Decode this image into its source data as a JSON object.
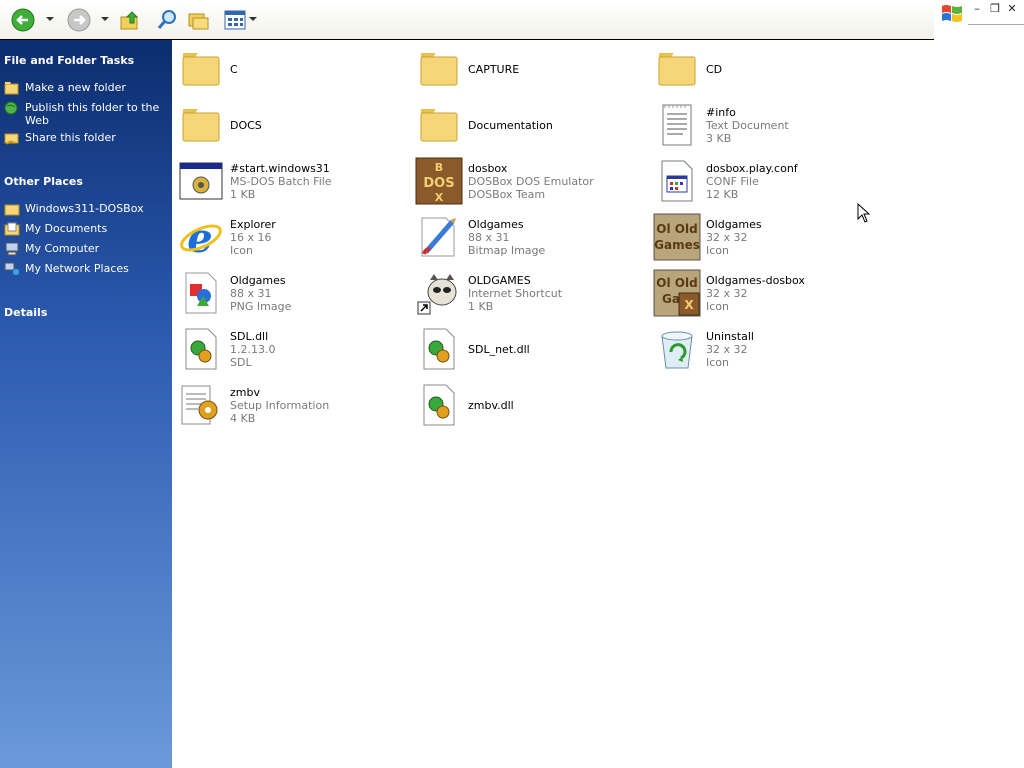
{
  "colors": {
    "pane_dark": "#0c2d6e",
    "pane_light": "#6b99da",
    "folder": "#f5d77a",
    "meta_gray": "#7a7a7a"
  },
  "toolbar": {
    "buttons": [
      {
        "icon": "back-arrow-icon"
      },
      {
        "icon": "forward-arrow-icon"
      },
      {
        "icon": "up-folder-icon"
      },
      {
        "icon": "search-icon"
      },
      {
        "icon": "folders-icon"
      },
      {
        "icon": "views-icon"
      }
    ]
  },
  "window_controls": {
    "minimize": "–",
    "restore": "❐",
    "close": "✕"
  },
  "taskpane": {
    "file_tasks": {
      "title": "File and Folder Tasks",
      "items": [
        {
          "label": "Make a new folder",
          "icon": "new-folder-icon"
        },
        {
          "label": "Publish this folder to the Web",
          "icon": "publish-web-icon"
        },
        {
          "label": "Share this folder",
          "icon": "share-folder-icon"
        }
      ]
    },
    "other_places": {
      "title": "Other Places",
      "items": [
        {
          "label": "Windows311-DOSBox",
          "icon": "folder-icon"
        },
        {
          "label": "My Documents",
          "icon": "my-documents-icon"
        },
        {
          "label": "My Computer",
          "icon": "my-computer-icon"
        },
        {
          "label": "My Network Places",
          "icon": "network-places-icon"
        }
      ]
    },
    "details": {
      "title": "Details"
    }
  },
  "files": [
    {
      "name": "C",
      "meta1": "",
      "meta2": "",
      "icon": "folder-icon"
    },
    {
      "name": "CAPTURE",
      "meta1": "",
      "meta2": "",
      "icon": "folder-icon"
    },
    {
      "name": "CD",
      "meta1": "",
      "meta2": "",
      "icon": "folder-icon"
    },
    {
      "name": "DOCS",
      "meta1": "",
      "meta2": "",
      "icon": "folder-icon"
    },
    {
      "name": "Documentation",
      "meta1": "",
      "meta2": "",
      "icon": "folder-icon"
    },
    {
      "name": "#info",
      "meta1": "Text Document",
      "meta2": "3 KB",
      "icon": "text-document-icon"
    },
    {
      "name": "#start.windows31",
      "meta1": "MS-DOS Batch File",
      "meta2": "1 KB",
      "icon": "batch-file-icon"
    },
    {
      "name": "dosbox",
      "meta1": "DOSBox DOS Emulator",
      "meta2": "DOSBox Team",
      "icon": "dosbox-icon"
    },
    {
      "name": "dosbox.play.conf",
      "meta1": "CONF File",
      "meta2": "12 KB",
      "icon": "conf-file-icon"
    },
    {
      "name": "Explorer",
      "meta1": "16 x 16",
      "meta2": "Icon",
      "icon": "internet-explorer-icon"
    },
    {
      "name": "Oldgames",
      "meta1": "88 x 31",
      "meta2": "Bitmap Image",
      "icon": "bitmap-image-icon"
    },
    {
      "name": "Oldgames",
      "meta1": "32 x 32",
      "meta2": "Icon",
      "icon": "oldgames-icon"
    },
    {
      "name": "Oldgames",
      "meta1": "88 x 31",
      "meta2": "PNG Image",
      "icon": "png-image-icon"
    },
    {
      "name": "OLDGAMES",
      "meta1": "Internet Shortcut",
      "meta2": "1 KB",
      "icon": "internet-shortcut-icon"
    },
    {
      "name": "Oldgames-dosbox",
      "meta1": "32 x 32",
      "meta2": "Icon",
      "icon": "oldgames-dosbox-icon"
    },
    {
      "name": "SDL.dll",
      "meta1": "1.2.13.0",
      "meta2": "SDL",
      "icon": "dll-file-icon"
    },
    {
      "name": "SDL_net.dll",
      "meta1": "",
      "meta2": "",
      "icon": "dll-file-icon"
    },
    {
      "name": "Uninstall",
      "meta1": "32 x 32",
      "meta2": "Icon",
      "icon": "recycle-bin-icon"
    },
    {
      "name": "zmbv",
      "meta1": "Setup Information",
      "meta2": "4 KB",
      "icon": "setup-information-icon"
    },
    {
      "name": "zmbv.dll",
      "meta1": "",
      "meta2": "",
      "icon": "dll-file-icon"
    }
  ]
}
